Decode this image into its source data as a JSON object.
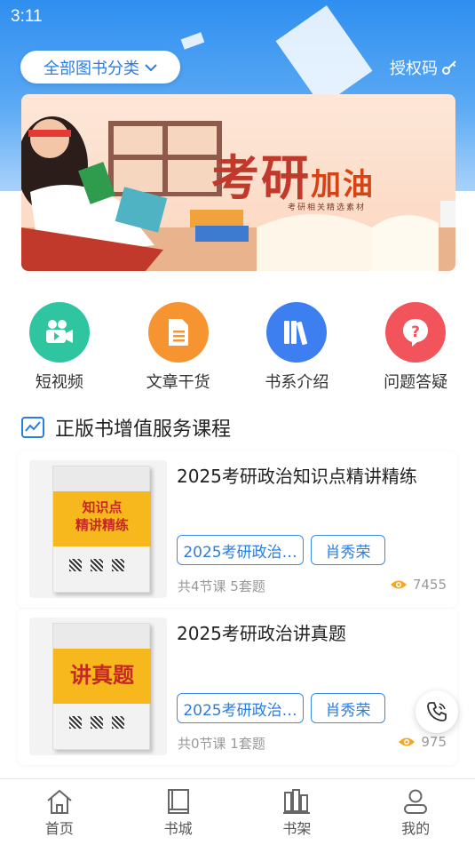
{
  "status_bar": {
    "time": "3:11"
  },
  "header": {
    "category_label": "全部图书分类",
    "auth_label": "授权码"
  },
  "banner": {
    "title_main": "考研",
    "title_accent": "加油",
    "subtitle": "考研相关精选素材"
  },
  "quick_nav": [
    {
      "label": "短视频",
      "icon": "video-camera-icon",
      "color": "#2fc5a0"
    },
    {
      "label": "文章干货",
      "icon": "document-icon",
      "color": "#f79432"
    },
    {
      "label": "书系介绍",
      "icon": "books-icon",
      "color": "#3d7ff0"
    },
    {
      "label": "问题答疑",
      "icon": "question-icon",
      "color": "#f2545b"
    }
  ],
  "section": {
    "title": "正版书增值服务课程"
  },
  "courses": [
    {
      "title": "2025考研政治知识点精讲精练",
      "cover_text": "知识点精讲精练",
      "tag1": "2025考研政治…",
      "tag2": "肖秀荣",
      "meta": "共4节课 5套题",
      "views": "7455"
    },
    {
      "title": "2025考研政治讲真题",
      "cover_text": "讲真题",
      "tag1": "2025考研政治…",
      "tag2": "肖秀荣",
      "meta": "共0节课 1套题",
      "views": "975"
    }
  ],
  "tabbar": [
    {
      "label": "首页",
      "icon": "home-icon"
    },
    {
      "label": "书城",
      "icon": "book-store-icon"
    },
    {
      "label": "书架",
      "icon": "bookshelf-icon"
    },
    {
      "label": "我的",
      "icon": "user-icon"
    }
  ],
  "colors": {
    "accent": "#2a7de1",
    "banner_title": "#c0392b",
    "tag_border": "#3b8be6",
    "view_icon": "#f5a623"
  }
}
